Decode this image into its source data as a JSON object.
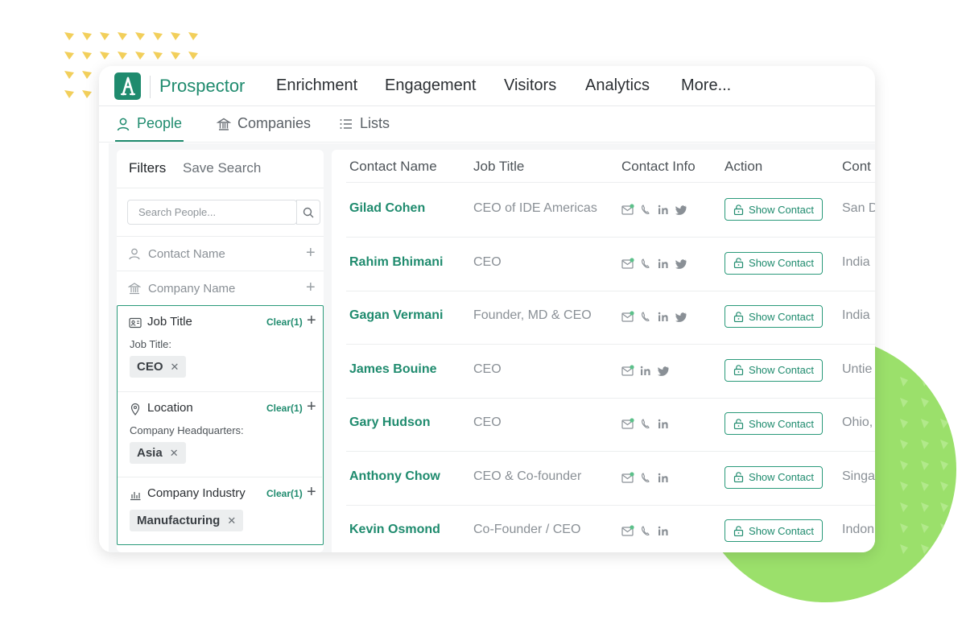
{
  "topnav": {
    "items": [
      {
        "label": "Prospector",
        "active": true
      },
      {
        "label": "Enrichment",
        "active": false
      },
      {
        "label": "Engagement",
        "active": false
      },
      {
        "label": "Visitors",
        "active": false
      },
      {
        "label": "Analytics",
        "active": false
      },
      {
        "label": "More...",
        "active": false
      }
    ]
  },
  "subnav": {
    "tabs": [
      {
        "label": "People",
        "icon": "person-icon",
        "active": true
      },
      {
        "label": "Companies",
        "icon": "building-icon",
        "active": false
      },
      {
        "label": "Lists",
        "icon": "list-icon",
        "active": false
      }
    ]
  },
  "filters": {
    "tab_filters": "Filters",
    "tab_save_search": "Save Search",
    "search_placeholder": "Search People...",
    "rows": [
      {
        "label": "Contact Name",
        "icon": "person-icon"
      },
      {
        "label": "Company Name",
        "icon": "building-icon"
      }
    ],
    "active": [
      {
        "title": "Job Title",
        "icon": "id-card-icon",
        "clear": "Clear(1)",
        "sub": "Job Title:",
        "chip": "CEO"
      },
      {
        "title": "Location",
        "icon": "location-pin-icon",
        "clear": "Clear(1)",
        "sub": "Company Headquarters:",
        "chip": "Asia"
      },
      {
        "title": "Company Industry",
        "icon": "bar-chart-icon",
        "clear": "Clear(1)",
        "chip": "Manufacturing"
      }
    ]
  },
  "table": {
    "columns": [
      "Contact Name",
      "Job Title",
      "Contact Info",
      "Action",
      "Cont"
    ],
    "button_label": "Show Contact",
    "rows": [
      {
        "name": "Gilad Cohen",
        "job": "CEO of IDE Americas",
        "location": "San D",
        "icons": [
          "email-icon",
          "phone-icon",
          "linkedin-icon",
          "twitter-icon"
        ]
      },
      {
        "name": "Rahim Bhimani",
        "job": "CEO",
        "location": "India",
        "icons": [
          "email-icon",
          "phone-icon",
          "linkedin-icon",
          "twitter-icon"
        ]
      },
      {
        "name": "Gagan Vermani",
        "job": "Founder, MD & CEO",
        "location": "India",
        "icons": [
          "email-icon",
          "phone-icon",
          "linkedin-icon",
          "twitter-icon"
        ]
      },
      {
        "name": "James Bouine",
        "job": "CEO",
        "location": "Untie",
        "icons": [
          "email-icon",
          "linkedin-icon",
          "twitter-icon"
        ]
      },
      {
        "name": "Gary Hudson",
        "job": "CEO",
        "location": "Ohio,",
        "icons": [
          "email-icon",
          "phone-icon",
          "linkedin-icon"
        ]
      },
      {
        "name": "Anthony Chow",
        "job": "CEO & Co-founder",
        "location": "Singa",
        "icons": [
          "email-icon",
          "phone-icon",
          "linkedin-icon"
        ]
      },
      {
        "name": "Kevin Osmond",
        "job": "Co-Founder / CEO",
        "location": "Indon",
        "icons": [
          "email-icon",
          "phone-icon",
          "linkedin-icon"
        ]
      }
    ]
  },
  "colors": {
    "brand": "#1f8b6e",
    "decor_green": "#9be06b",
    "decor_yellow": "#f2cf5b"
  }
}
